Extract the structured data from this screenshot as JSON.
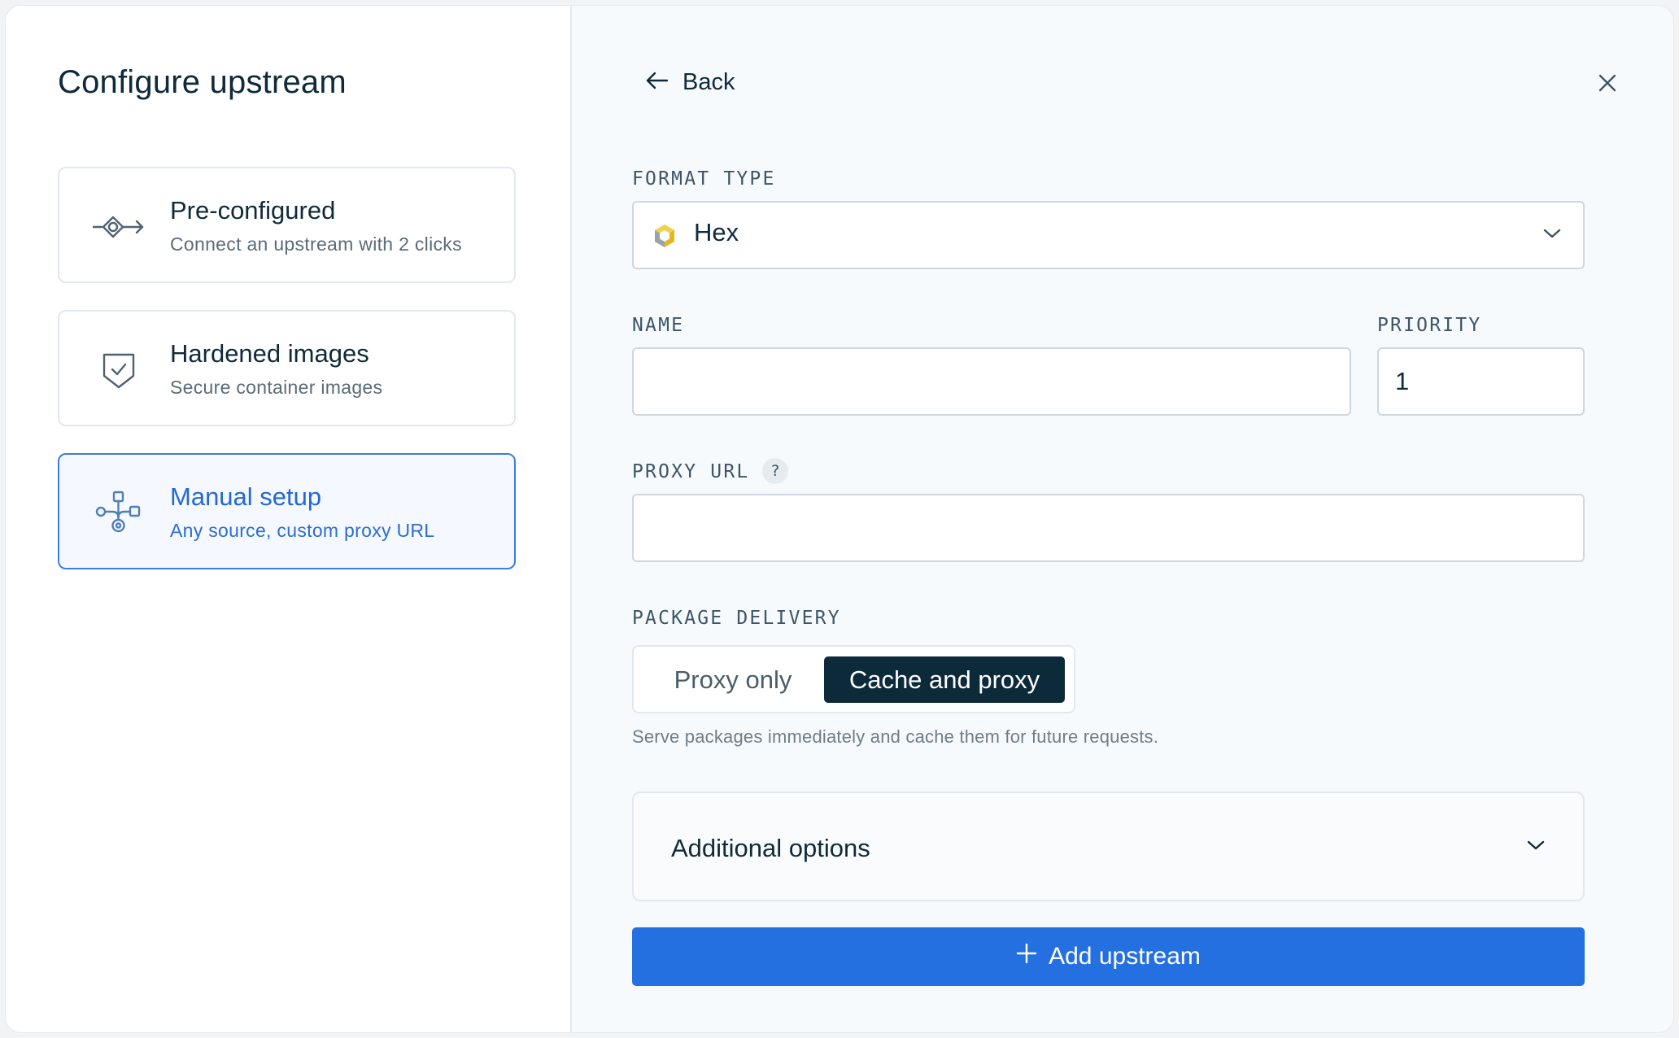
{
  "left": {
    "title": "Configure upstream",
    "options": [
      {
        "title": "Pre-configured",
        "desc": "Connect an upstream with 2 clicks",
        "icon": "connection-arrow-icon",
        "selected": false
      },
      {
        "title": "Hardened images",
        "desc": "Secure container images",
        "icon": "shield-check-icon",
        "selected": false
      },
      {
        "title": "Manual setup",
        "desc": "Any source, custom proxy URL",
        "icon": "network-nodes-icon",
        "selected": true
      }
    ]
  },
  "right": {
    "back_label": "Back",
    "format_type": {
      "label": "FORMAT TYPE",
      "value": "Hex",
      "icon": "hex-logo-icon"
    },
    "name": {
      "label": "NAME",
      "value": "",
      "placeholder": ""
    },
    "priority": {
      "label": "PRIORITY",
      "value": "1"
    },
    "proxy_url": {
      "label": "PROXY URL",
      "help": "?",
      "value": "",
      "placeholder": ""
    },
    "package_delivery": {
      "label": "PACKAGE DELIVERY",
      "options": [
        "Proxy only",
        "Cache and proxy"
      ],
      "selected": "Cache and proxy",
      "helper": "Serve packages immediately and cache them for future requests."
    },
    "additional_options": {
      "title": "Additional options"
    },
    "submit_label": "Add upstream"
  },
  "colors": {
    "accent": "#2570e0",
    "selected_border": "#3c7fd9",
    "dark_toggle": "#0d2a3b",
    "text_primary": "#0f2a3a"
  }
}
